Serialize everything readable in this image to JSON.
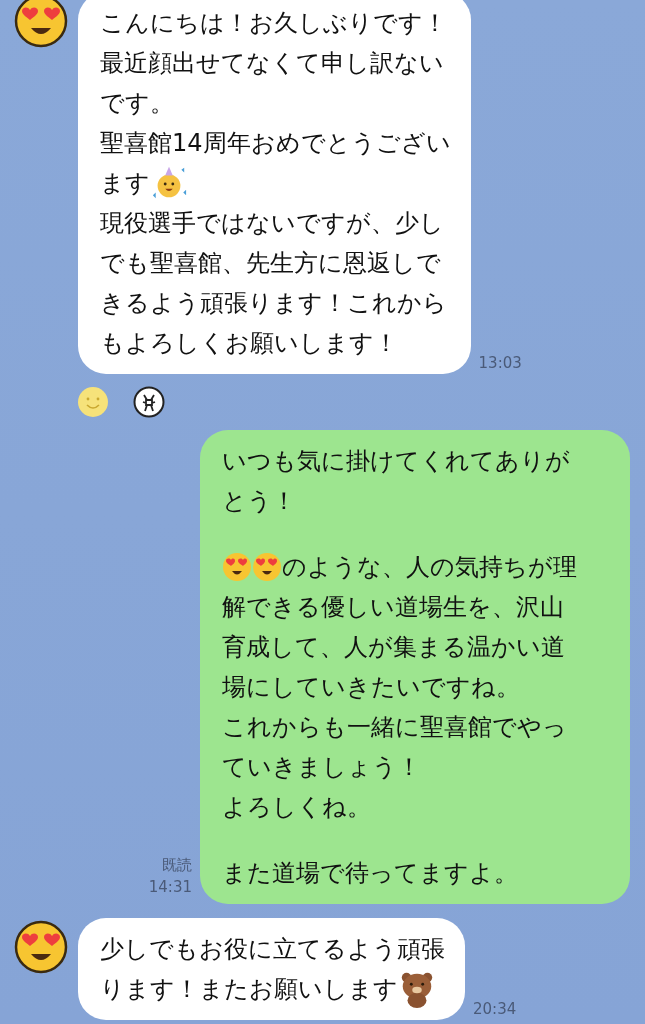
{
  "messages": [
    {
      "kind": "incoming",
      "time": "13:03",
      "paragraphs": [
        [
          {
            "parts": [
              {
                "kind": "text",
                "text": "こんにちは！お久しぶりです！"
              }
            ]
          },
          {
            "parts": [
              {
                "kind": "text",
                "text": "最近顔出せてなくて申し訳ない"
              }
            ]
          },
          {
            "parts": [
              {
                "kind": "text",
                "text": "です。"
              }
            ]
          },
          {
            "parts": [
              {
                "kind": "text",
                "text": "聖喜館14周年おめでとうござい"
              }
            ]
          },
          {
            "parts": [
              {
                "kind": "text",
                "text": "ます"
              },
              {
                "kind": "party"
              }
            ]
          },
          {
            "parts": [
              {
                "kind": "text",
                "text": "現役選手ではないですが、少し"
              }
            ]
          },
          {
            "parts": [
              {
                "kind": "text",
                "text": "でも聖喜館、先生方に恩返しで"
              }
            ]
          },
          {
            "parts": [
              {
                "kind": "text",
                "text": "きるよう頑張ります！これから"
              }
            ]
          },
          {
            "parts": [
              {
                "kind": "text",
                "text": "もよろしくお願いします！"
              }
            ]
          }
        ]
      ],
      "reactions": [
        {
          "kind": "smiley"
        },
        {
          "kind": "figure"
        }
      ]
    },
    {
      "kind": "outgoing",
      "read": "既読",
      "time": "14:31",
      "paragraphs": [
        [
          {
            "parts": [
              {
                "kind": "text",
                "text": "いつも気に掛けてくれてありが"
              }
            ]
          },
          {
            "parts": [
              {
                "kind": "text",
                "text": "とう！"
              }
            ]
          }
        ],
        [
          {
            "parts": [
              {
                "kind": "heart-eyes"
              },
              {
                "kind": "heart-eyes"
              },
              {
                "kind": "text",
                "text": "のような、人の気持ちが理"
              }
            ]
          },
          {
            "parts": [
              {
                "kind": "text",
                "text": "解できる優しい道場生を、沢山"
              }
            ]
          },
          {
            "parts": [
              {
                "kind": "text",
                "text": "育成して、人が集まる温かい道"
              }
            ]
          },
          {
            "parts": [
              {
                "kind": "text",
                "text": "場にしていきたいですね。"
              }
            ]
          },
          {
            "parts": [
              {
                "kind": "text",
                "text": "これからも一緒に聖喜館でやっ"
              }
            ]
          },
          {
            "parts": [
              {
                "kind": "text",
                "text": "ていきましょう！"
              }
            ]
          },
          {
            "parts": [
              {
                "kind": "text",
                "text": "よろしくね。"
              }
            ]
          }
        ],
        [
          {
            "parts": [
              {
                "kind": "text",
                "text": "また道場で待ってますよ。"
              }
            ]
          }
        ]
      ]
    },
    {
      "kind": "incoming",
      "time": "20:34",
      "paragraphs": [
        [
          {
            "parts": [
              {
                "kind": "text",
                "text": "少しでもお役に立てるよう頑張"
              }
            ]
          },
          {
            "parts": [
              {
                "kind": "text",
                "text": "ります！またお願いします"
              },
              {
                "kind": "bear"
              }
            ]
          }
        ]
      ]
    }
  ]
}
